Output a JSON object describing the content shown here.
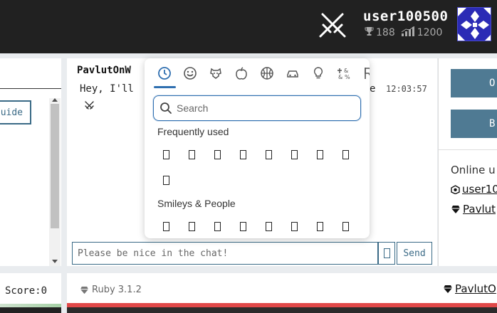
{
  "header": {
    "username": "user100500",
    "wins": "188",
    "rating": "1200",
    "icons": [
      "crossed-swords-icon",
      "trophy-icon",
      "rating-chart-icon",
      "avatar"
    ]
  },
  "left_panel": {
    "guide_label": "uide"
  },
  "chat": {
    "author": "PavlutOnW",
    "message_start": "Hey, I'll",
    "message_end": "e",
    "time": "12:03:57",
    "input_placeholder": "Please be nice in the chat!",
    "send_label": "Send"
  },
  "emoji_picker": {
    "categories": [
      "recent",
      "smileys",
      "animals",
      "food",
      "activity",
      "travel",
      "objects",
      "symbols",
      "flags"
    ],
    "search_placeholder": "Search",
    "frequently_used_label": "Frequently used",
    "smileys_label": "Smileys & People",
    "frequently_used_count": 9,
    "smileys_visible_count": 8
  },
  "right_panel": {
    "btn1_label": "O",
    "btn2_label": "B",
    "online_label": "Online u",
    "user1": "user10",
    "user2": "Pavlut"
  },
  "bottom": {
    "score_label": "Score:0",
    "language": "Ruby 3.1.2",
    "player": "PavlutO"
  },
  "colors": {
    "topbar": "#212121",
    "accent": "#3a6a86",
    "picker_accent": "#2f6fb0",
    "red_bar": "#e04848"
  }
}
